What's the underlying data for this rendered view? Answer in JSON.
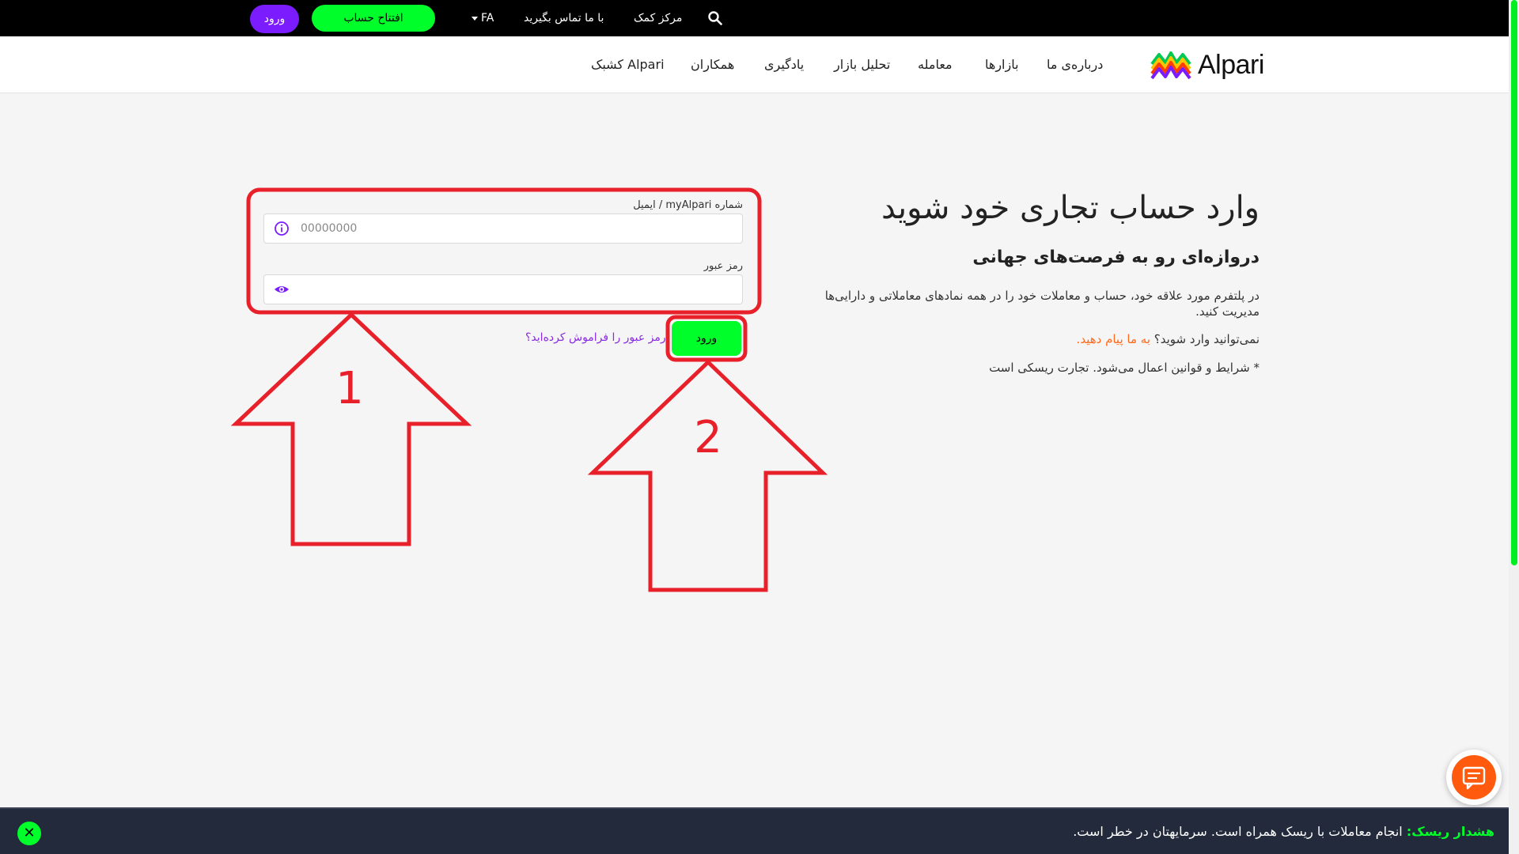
{
  "topbar": {
    "login_label": "ورود",
    "open_account_label": "افتتاح حساب",
    "language": "FA",
    "contact_label": "با ما تماس بگیرید",
    "help_center_label": "مرکز کمک"
  },
  "navbar": {
    "brand": "Alpari",
    "items": [
      "درباره‌ی ما",
      "بازارها",
      "معامله",
      "تحلیل بازار",
      "یادگیری",
      "همکاران",
      "کشبک Alpari"
    ]
  },
  "main": {
    "heading": "وارد حساب تجاری خود شوید",
    "subheading": "دروازه‌ای رو به فرصت‌های جهانی",
    "description": "در پلتفرم مورد علاقه خود، حساب و معاملات خود را در همه نمادهای معاملاتی و دارایی‌ها مدیریت کنید.",
    "cant_login": "نمی‌توانید وارد شوید؟",
    "message_us": "به ما پیام دهید.",
    "terms": "* شرایط و قوانین اعمال می‌شود. تجارت ریسکی است"
  },
  "form": {
    "account_label": "شماره myAlpari / ایمیل",
    "account_placeholder": "00000000",
    "password_label": "رمز عبور",
    "password_value": "",
    "login_button": "ورود",
    "forgot_link": "رمز عبور را فراموش کرده‌اید؟"
  },
  "annotations": {
    "arrow1_label": "1",
    "arrow2_label": "2",
    "color": "#e8202a"
  },
  "risk": {
    "label": "هشدار ریسک:",
    "text": " انجام معاملات با ریسک همراه است. سرمایهتان در خطر است."
  },
  "colors": {
    "accent_green": "#00ff2a",
    "accent_purple": "#7b1cff",
    "link_orange": "#ff6a1a"
  }
}
